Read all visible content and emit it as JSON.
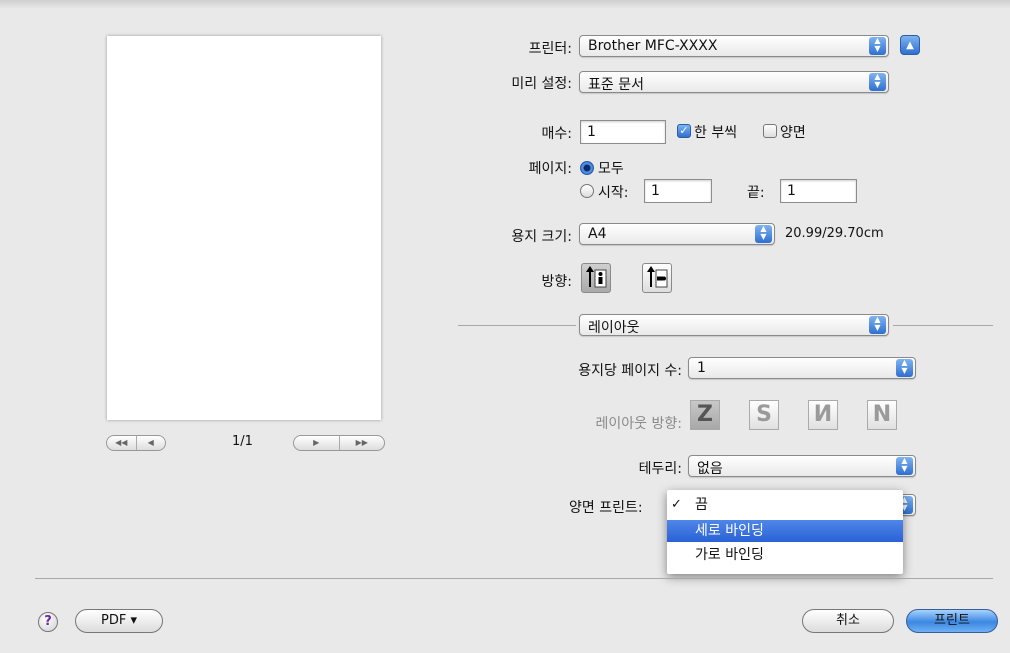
{
  "printer": {
    "label": "프린터:",
    "value": "Brother MFC-XXXX"
  },
  "presets": {
    "label": "미리 설정:",
    "value": "표준 문서"
  },
  "copies": {
    "label": "매수:",
    "value": "1",
    "collated_label": "한 부씩",
    "duplex_label": "양면"
  },
  "pages": {
    "label": "페이지:",
    "all_label": "모두",
    "from_label": "시작:",
    "from_value": "1",
    "to_label": "끝:",
    "to_value": "1"
  },
  "paper": {
    "label": "용지 크기:",
    "value": "A4",
    "size_text": "20.99/29.70cm"
  },
  "orientation": {
    "label": "방향:"
  },
  "panel": {
    "value": "레이아웃"
  },
  "layout": {
    "pages_per_sheet_label": "용지당 페이지 수:",
    "pages_per_sheet_value": "1",
    "direction_label": "레이아웃 방향:",
    "border_label": "테두리:",
    "border_value": "없음",
    "two_sided_label": "양면 프린트:"
  },
  "two_sided_menu": {
    "items": [
      {
        "label": "끔",
        "checked": true
      },
      {
        "label": "세로 바인딩",
        "highlighted": true
      },
      {
        "label": "가로 바인딩"
      }
    ]
  },
  "preview_nav": {
    "page_indicator": "1/1"
  },
  "footer": {
    "help": "?",
    "pdf_label": "PDF ▾",
    "cancel_label": "취소",
    "print_label": "프린트"
  },
  "colors": {
    "accent": "#2e6fd1",
    "menu_highlight": "#2a62d6"
  }
}
